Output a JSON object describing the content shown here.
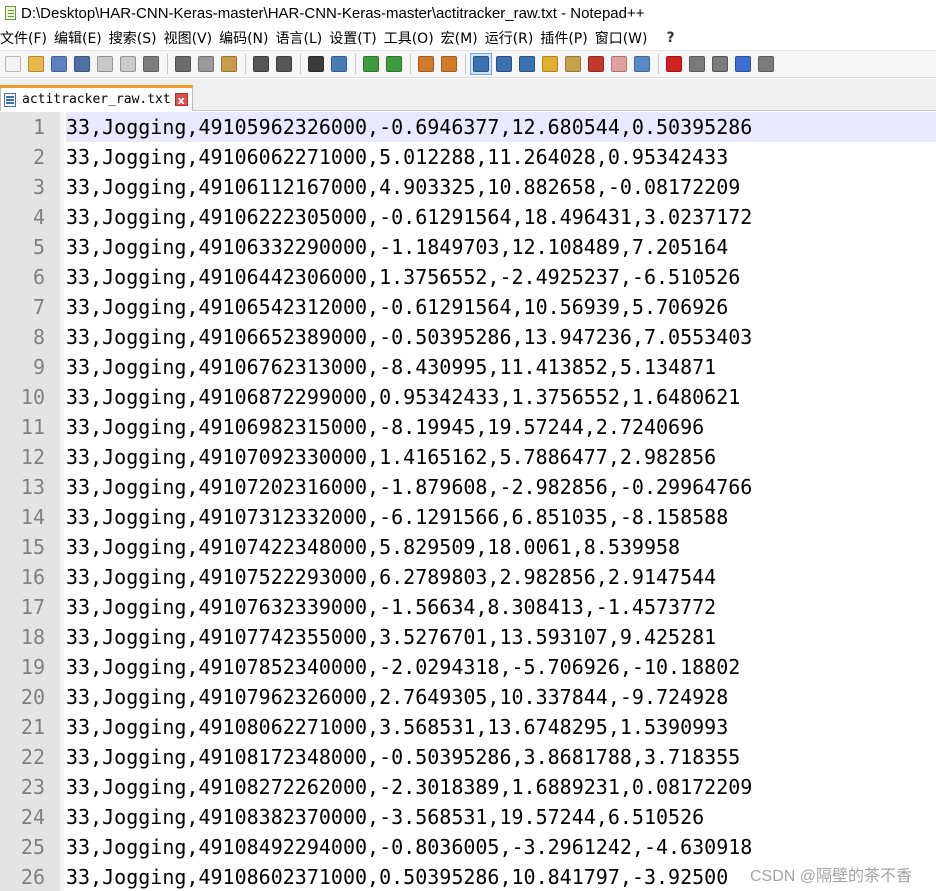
{
  "window": {
    "title": "D:\\Desktop\\HAR-CNN-Keras-master\\HAR-CNN-Keras-master\\actitracker_raw.txt - Notepad++"
  },
  "menu": {
    "items": [
      "文件(F)",
      "编辑(E)",
      "搜索(S)",
      "视图(V)",
      "编码(N)",
      "语言(L)",
      "设置(T)",
      "工具(O)",
      "宏(M)",
      "运行(R)",
      "插件(P)",
      "窗口(W)"
    ],
    "close": "?"
  },
  "toolbar": {
    "buttons": [
      {
        "icon": "new-file-icon",
        "color": "#f2f2f2"
      },
      {
        "icon": "open-file-icon",
        "color": "#e8b84a"
      },
      {
        "icon": "save-icon",
        "color": "#5b7fbf"
      },
      {
        "icon": "save-all-icon",
        "color": "#4f6fa8"
      },
      {
        "icon": "close-icon",
        "color": "#c9c9c9"
      },
      {
        "icon": "close-all-icon",
        "color": "#c9c9c9"
      },
      {
        "icon": "print-icon",
        "color": "#7e7e7e"
      },
      {
        "icon": "cut-icon",
        "color": "#6b6b6b"
      },
      {
        "icon": "copy-icon",
        "color": "#9a9a9a"
      },
      {
        "icon": "paste-icon",
        "color": "#c89b4a"
      },
      {
        "icon": "undo-icon",
        "color": "#555555"
      },
      {
        "icon": "redo-icon",
        "color": "#555555"
      },
      {
        "icon": "find-icon",
        "color": "#3a3a3a"
      },
      {
        "icon": "replace-icon",
        "color": "#4a7bb7"
      },
      {
        "icon": "zoom-in-icon",
        "color": "#3d9b3d"
      },
      {
        "icon": "zoom-out-icon",
        "color": "#3d9b3d"
      },
      {
        "icon": "sync-vertical-icon",
        "color": "#d07a2a"
      },
      {
        "icon": "sync-horizontal-icon",
        "color": "#d07a2a"
      },
      {
        "icon": "word-wrap-icon",
        "color": "#3a6fb0"
      },
      {
        "icon": "show-all-characters-icon",
        "color": "#3a6fb0"
      },
      {
        "icon": "indent-guide-icon",
        "color": "#3a6fb0"
      },
      {
        "icon": "language-icon",
        "color": "#e0b030"
      },
      {
        "icon": "document-map-icon",
        "color": "#c8a050"
      },
      {
        "icon": "function-list-icon",
        "color": "#c0392b"
      },
      {
        "icon": "folder-workspace-icon",
        "color": "#e0a0a0"
      },
      {
        "icon": "monitoring-icon",
        "color": "#5a8ac6"
      },
      {
        "icon": "record-macro-icon",
        "color": "#d02020"
      },
      {
        "icon": "stop-recording-icon",
        "color": "#7a7a7a"
      },
      {
        "icon": "playback-macro-icon",
        "color": "#7a7a7a"
      },
      {
        "icon": "run-macro-multiple-icon",
        "color": "#3a6fd0"
      },
      {
        "icon": "save-macro-icon",
        "color": "#7a7a7a"
      }
    ]
  },
  "tab": {
    "label": "actitracker_raw.txt",
    "close": "x"
  },
  "editor": {
    "lines": [
      {
        "num": "1",
        "text": "33,Jogging,49105962326000,-0.6946377,12.680544,0.50395286"
      },
      {
        "num": "2",
        "text": "33,Jogging,49106062271000,5.012288,11.264028,0.95342433"
      },
      {
        "num": "3",
        "text": "33,Jogging,49106112167000,4.903325,10.882658,-0.08172209"
      },
      {
        "num": "4",
        "text": "33,Jogging,49106222305000,-0.61291564,18.496431,3.0237172"
      },
      {
        "num": "5",
        "text": "33,Jogging,49106332290000,-1.1849703,12.108489,7.205164"
      },
      {
        "num": "6",
        "text": "33,Jogging,49106442306000,1.3756552,-2.4925237,-6.510526"
      },
      {
        "num": "7",
        "text": "33,Jogging,49106542312000,-0.61291564,10.56939,5.706926"
      },
      {
        "num": "8",
        "text": "33,Jogging,49106652389000,-0.50395286,13.947236,7.0553403"
      },
      {
        "num": "9",
        "text": "33,Jogging,49106762313000,-8.430995,11.413852,5.134871"
      },
      {
        "num": "10",
        "text": "33,Jogging,49106872299000,0.95342433,1.3756552,1.6480621"
      },
      {
        "num": "11",
        "text": "33,Jogging,49106982315000,-8.19945,19.57244,2.7240696"
      },
      {
        "num": "12",
        "text": "33,Jogging,49107092330000,1.4165162,5.7886477,2.982856"
      },
      {
        "num": "13",
        "text": "33,Jogging,49107202316000,-1.879608,-2.982856,-0.29964766"
      },
      {
        "num": "14",
        "text": "33,Jogging,49107312332000,-6.1291566,6.851035,-8.158588"
      },
      {
        "num": "15",
        "text": "33,Jogging,49107422348000,5.829509,18.0061,8.539958"
      },
      {
        "num": "16",
        "text": "33,Jogging,49107522293000,6.2789803,2.982856,2.9147544"
      },
      {
        "num": "17",
        "text": "33,Jogging,49107632339000,-1.56634,8.308413,-1.4573772"
      },
      {
        "num": "18",
        "text": "33,Jogging,49107742355000,3.5276701,13.593107,9.425281"
      },
      {
        "num": "19",
        "text": "33,Jogging,49107852340000,-2.0294318,-5.706926,-10.18802"
      },
      {
        "num": "20",
        "text": "33,Jogging,49107962326000,2.7649305,10.337844,-9.724928"
      },
      {
        "num": "21",
        "text": "33,Jogging,49108062271000,3.568531,13.6748295,1.5390993"
      },
      {
        "num": "22",
        "text": "33,Jogging,49108172348000,-0.50395286,3.8681788,3.718355"
      },
      {
        "num": "23",
        "text": "33,Jogging,49108272262000,-2.3018389,1.6889231,0.08172209"
      },
      {
        "num": "24",
        "text": "33,Jogging,49108382370000,-3.568531,19.57244,6.510526"
      },
      {
        "num": "25",
        "text": "33,Jogging,49108492294000,-0.8036005,-3.2961242,-4.630918"
      },
      {
        "num": "26",
        "text": "33,Jogging,49108602371000,0.50395286,10.841797,-3.92500"
      }
    ]
  },
  "watermark": "CSDN @隔壁的茶不香"
}
